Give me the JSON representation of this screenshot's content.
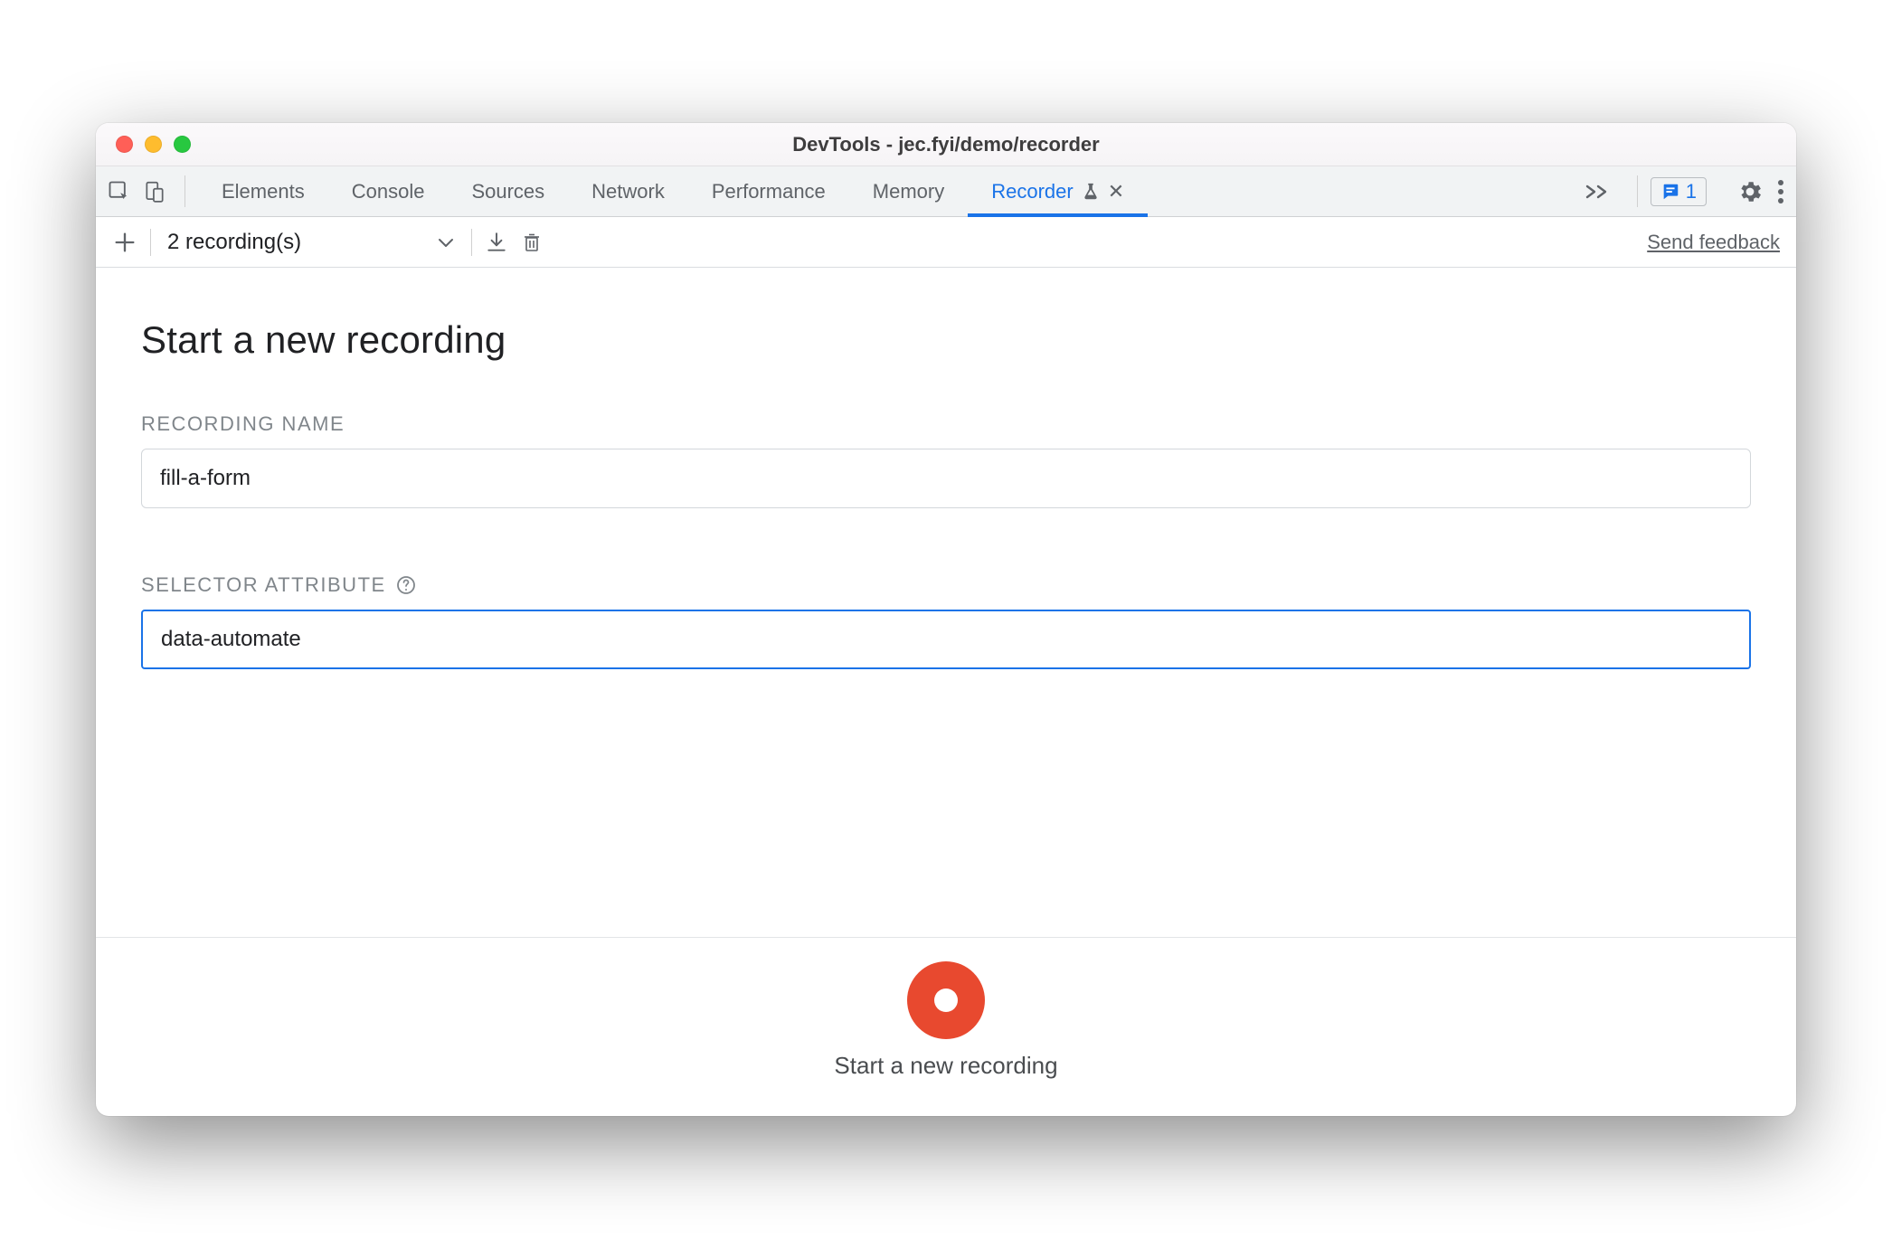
{
  "window": {
    "title": "DevTools - jec.fyi/demo/recorder"
  },
  "tabs": {
    "items": [
      {
        "label": "Elements"
      },
      {
        "label": "Console"
      },
      {
        "label": "Sources"
      },
      {
        "label": "Network"
      },
      {
        "label": "Performance"
      },
      {
        "label": "Memory"
      },
      {
        "label": "Recorder",
        "active": true,
        "experimental": true,
        "closable": true
      }
    ]
  },
  "issues": {
    "count": "1"
  },
  "toolbar": {
    "recordings_summary": "2 recording(s)",
    "feedback_label": "Send feedback"
  },
  "main": {
    "page_title": "Start a new recording",
    "fields": {
      "recording_name": {
        "label": "RECORDING NAME",
        "value": "fill-a-form"
      },
      "selector_attribute": {
        "label": "SELECTOR ATTRIBUTE",
        "value": "data-automate"
      }
    },
    "record_button_label": "Start a new recording"
  }
}
